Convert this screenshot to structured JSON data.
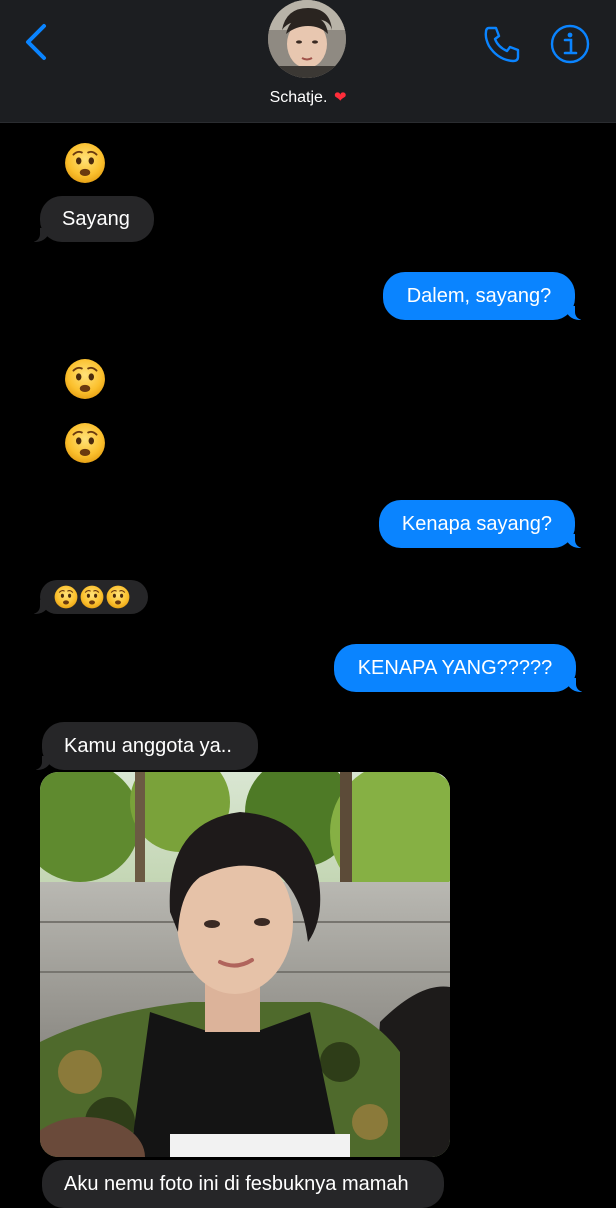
{
  "header": {
    "contact_name": "Schatje.",
    "heart": "❤"
  },
  "icons": {
    "back": "chevron-left-icon",
    "call": "phone-icon",
    "info": "info-icon",
    "emoji": "worried-face-emoji"
  },
  "colors": {
    "accent": "#0a84ff",
    "incoming_bubble": "#262628",
    "outgoing_bubble": "#0a84ff",
    "header_bg": "#1c1e21",
    "background": "#000000"
  },
  "messages": [
    {
      "from": "them",
      "type": "emoji",
      "count": 1
    },
    {
      "from": "them",
      "type": "text",
      "text": "Sayang"
    },
    {
      "from": "me",
      "type": "text",
      "text": "Dalem, sayang?"
    },
    {
      "from": "them",
      "type": "emoji",
      "count": 1
    },
    {
      "from": "them",
      "type": "emoji",
      "count": 1
    },
    {
      "from": "me",
      "type": "text",
      "text": "Kenapa sayang?"
    },
    {
      "from": "them",
      "type": "emoji-bubble",
      "count": 3
    },
    {
      "from": "me",
      "type": "text",
      "text": "KENAPA YANG?????"
    },
    {
      "from": "them",
      "type": "text",
      "text": "Kamu anggota ya.."
    },
    {
      "from": "them",
      "type": "photo"
    },
    {
      "from": "them",
      "type": "text",
      "text": "Aku nemu foto ini di fesbuknya mamah"
    }
  ]
}
